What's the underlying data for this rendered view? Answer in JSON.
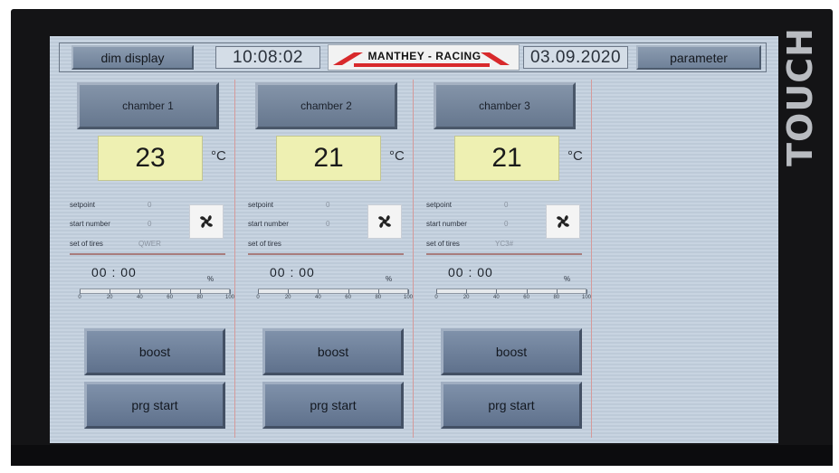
{
  "topbar": {
    "dim_label": "dim display",
    "time": "10:08:02",
    "logo_text": "MANTHEY - RACING",
    "date": "03.09.2020",
    "param_label": "parameter"
  },
  "bezel_text": "TOUCH",
  "chambers": [
    {
      "name": "chamber 1",
      "temperature": "23",
      "unit": "°C",
      "setpoint_label": "setpoint",
      "setpoint": "0",
      "start_number_label": "start number",
      "start_number": "0",
      "tires_label": "set of tires",
      "tires": "QWER",
      "timer": "00 : 00",
      "percent_symbol": "%",
      "progress": 0,
      "scale": [
        "0",
        "20",
        "40",
        "60",
        "80",
        "100"
      ],
      "boost_label": "boost",
      "prg_label": "prg start"
    },
    {
      "name": "chamber 2",
      "temperature": "21",
      "unit": "°C",
      "setpoint_label": "setpoint",
      "setpoint": "0",
      "start_number_label": "start number",
      "start_number": "0",
      "tires_label": "set of tires",
      "tires": "",
      "timer": "00 : 00",
      "percent_symbol": "%",
      "progress": 0,
      "scale": [
        "0",
        "20",
        "40",
        "60",
        "80",
        "100"
      ],
      "boost_label": "boost",
      "prg_label": "prg start"
    },
    {
      "name": "chamber 3",
      "temperature": "21",
      "unit": "°C",
      "setpoint_label": "setpoint",
      "setpoint": "0",
      "start_number_label": "start number",
      "start_number": "0",
      "tires_label": "set of tires",
      "tires": "YC3#",
      "timer": "00 : 00",
      "percent_symbol": "%",
      "progress": 0,
      "scale": [
        "0",
        "20",
        "40",
        "60",
        "80",
        "100"
      ],
      "boost_label": "boost",
      "prg_label": "prg start"
    }
  ],
  "colors": {
    "screen_bg": "#c8d4e1",
    "temp_bg": "#eef0b2",
    "logo_red": "#d8292b",
    "column_divider": "#d59a9a"
  },
  "icons": {
    "fan": "fan-icon"
  }
}
